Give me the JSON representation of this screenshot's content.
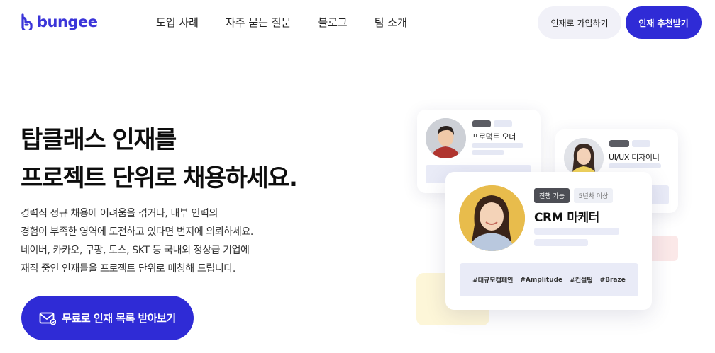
{
  "brand": {
    "name": "bungee",
    "color": "#3b35d9"
  },
  "nav": {
    "items": [
      {
        "label": "도입 사례"
      },
      {
        "label": "자주 묻는 질문"
      },
      {
        "label": "블로그"
      },
      {
        "label": "팀 소개"
      }
    ]
  },
  "header_actions": {
    "join_label": "인재로 가입하기",
    "recommend_label": "인재 추천받기"
  },
  "hero": {
    "title_line1": "탑클래스 인재를",
    "title_line2": "프로젝트 단위로 채용하세요.",
    "desc_lines": [
      "경력직 정규 채용에 어려움을 겪거나, 내부 인력의",
      "경험이 부족한 영역에 도전하고 있다면 번지에 의뢰하세요.",
      "네이버, 카카오, 쿠팡, 토스, SKT 등 국내외 정상급 기업에",
      "재직 중인 인재들을 프로젝트 단위로 매칭해 드립니다."
    ],
    "cta_label": "무료로 인재 목록 받아보기",
    "cta_icon": "mail-icon"
  },
  "profiles": {
    "product_owner": {
      "role": "프로덕트 오너"
    },
    "uiux": {
      "role": "UI/UX 디자이너"
    },
    "crm": {
      "status_tag": "진행 가능",
      "experience_tag": "5년차 이상",
      "role": "CRM 마케터",
      "hashtags": [
        "#대규모캠페인",
        "#Amplitude",
        "#컨설팅",
        "#Braze"
      ]
    }
  },
  "colors": {
    "accent": "#2f2bd6",
    "join_button_bg": "#f1f1f8",
    "bar_light": "#e9ebf7",
    "yellow_deco": "#fdf6d8",
    "pink_deco": "#fbe8e8"
  }
}
